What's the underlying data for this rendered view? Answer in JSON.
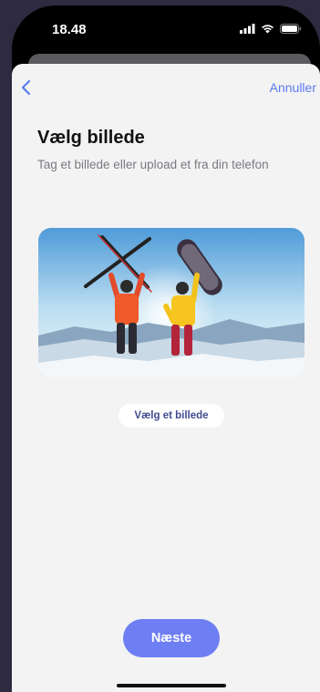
{
  "status_bar": {
    "time": "18.48",
    "icons": [
      "signal-icon",
      "wifi-icon",
      "battery-icon"
    ]
  },
  "nav": {
    "back_icon": "chevron-left-icon",
    "cancel_label": "Annuller"
  },
  "content": {
    "title": "Vælg billede",
    "subtitle": "Tag et billede eller upload et fra din telefon",
    "image_description": "ski-photo",
    "pick_button_label": "Vælg et billede"
  },
  "footer": {
    "next_button_label": "Næste"
  },
  "colors": {
    "accent": "#5b7bee",
    "primary_button": "#6d7ff2",
    "sheet_background": "#f3f3f4",
    "outer_background": "#2e2a3f"
  }
}
